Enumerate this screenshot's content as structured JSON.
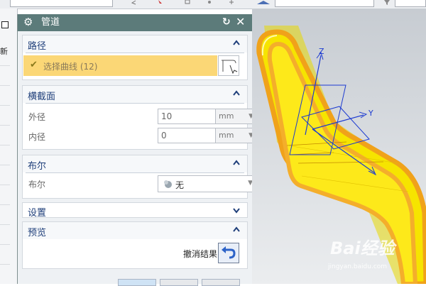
{
  "dialog": {
    "title": "管道",
    "sections": {
      "path": {
        "title": "路径",
        "select_curve_label": "选择曲线 (12)"
      },
      "cross_section": {
        "title": "横截面",
        "outer_label": "外径",
        "outer_value": "10",
        "outer_unit": "mm",
        "inner_label": "内径",
        "inner_value": "0",
        "inner_unit": "mm"
      },
      "boolean": {
        "title": "布尔",
        "label": "布尔",
        "value": "无"
      },
      "settings": {
        "title": "设置"
      },
      "preview": {
        "title": "预览",
        "undo_label": "撤消结果"
      }
    }
  },
  "left_panel": {
    "new_label": "新"
  },
  "viewport": {
    "axis_labels": {
      "z": "Z",
      "y": "Y"
    },
    "watermark": "Bai经验",
    "watermark_url": "jingyan.baidu.com"
  },
  "colors": {
    "titlebar": "#5c7b7a",
    "section_title": "#1f3f7a",
    "selection_highlight": "#fbd776",
    "model_yellow": "#f5e100",
    "model_orange": "#f2a21a"
  }
}
